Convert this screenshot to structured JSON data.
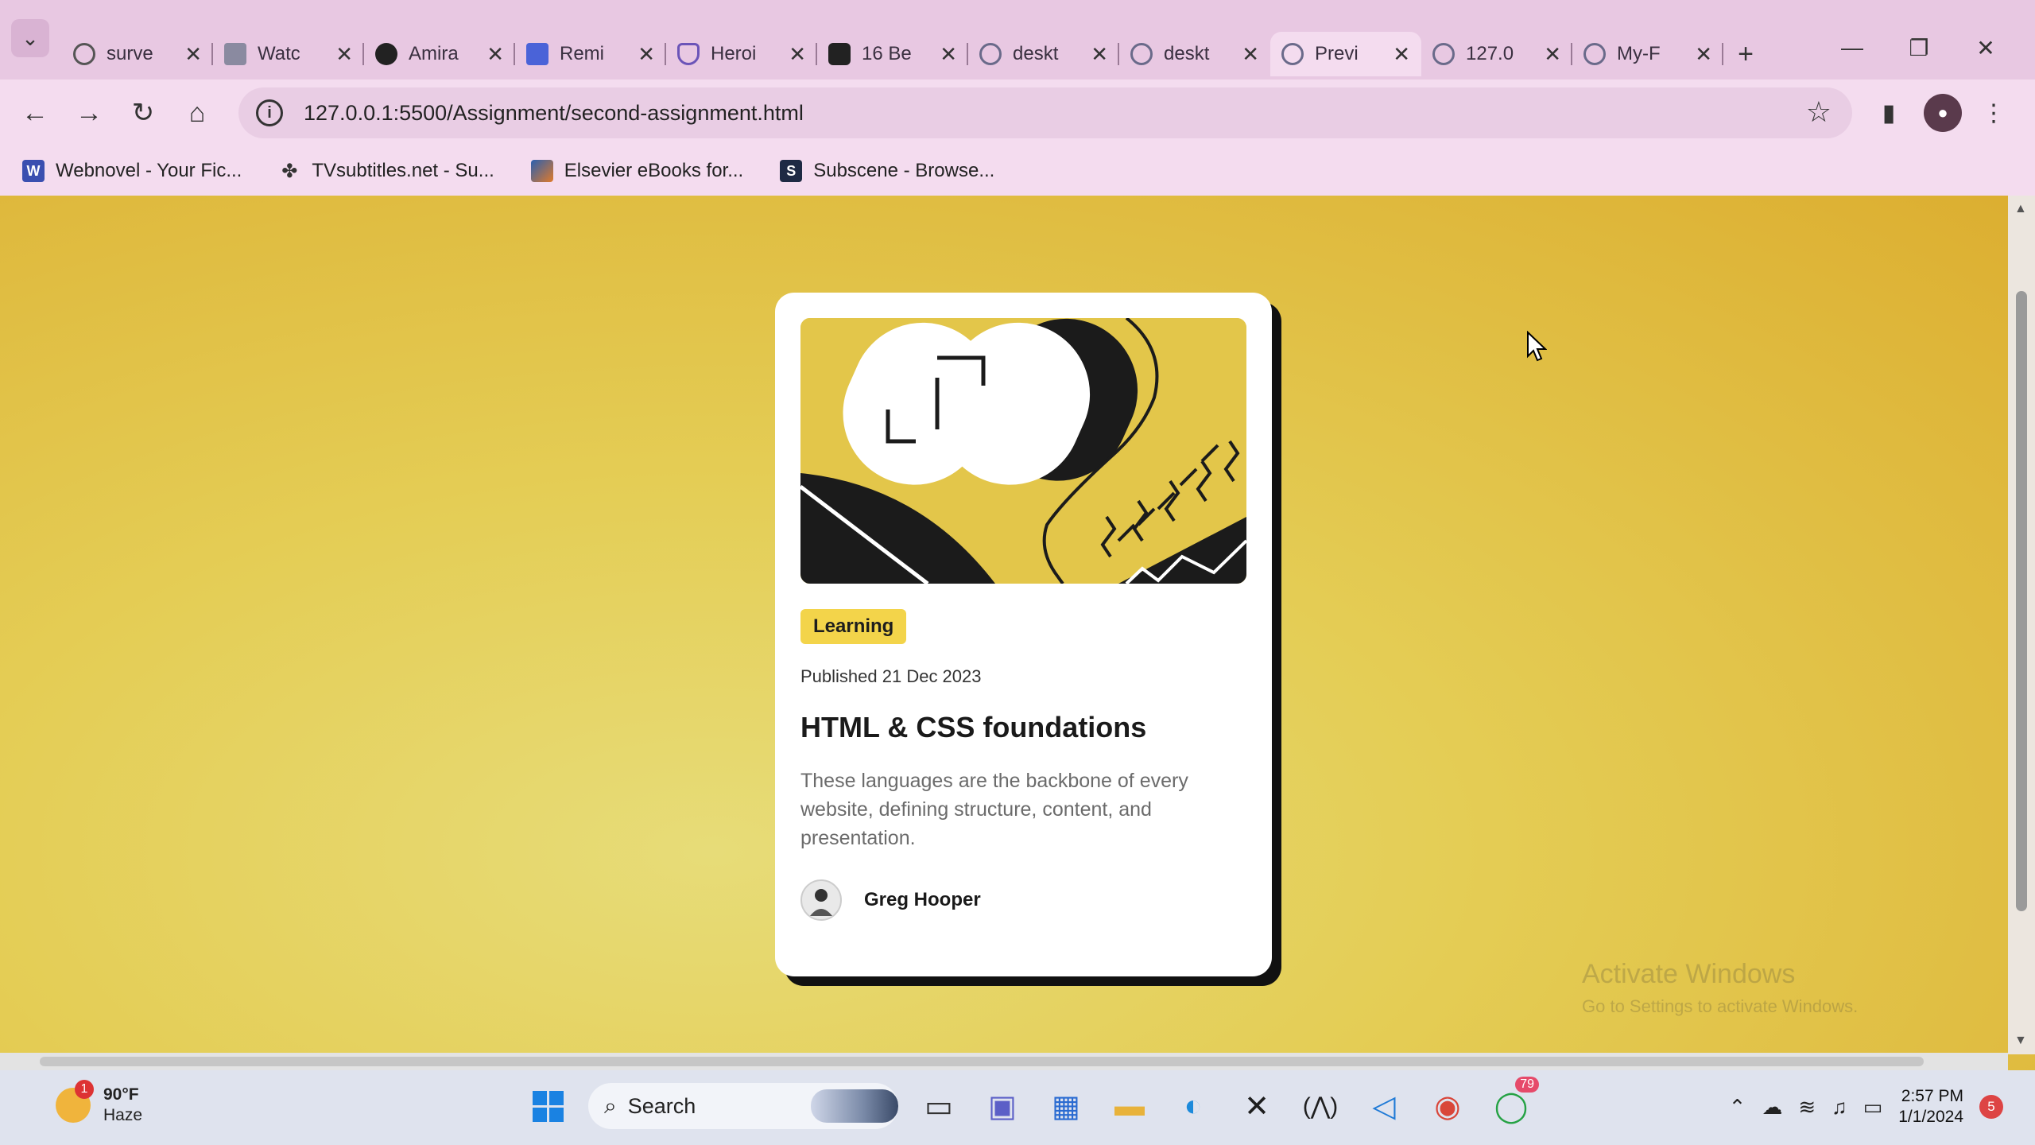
{
  "browser": {
    "tabs": [
      {
        "title": "surve",
        "icon": "loading-icon"
      },
      {
        "title": "Watc",
        "icon": "page-icon"
      },
      {
        "title": "Amira",
        "icon": "github-icon"
      },
      {
        "title": "Remi",
        "icon": "bookmark-icon"
      },
      {
        "title": "Heroi",
        "icon": "shield-icon"
      },
      {
        "title": "16 Be",
        "icon": "dice-icon"
      },
      {
        "title": "deskt",
        "icon": "globe-icon"
      },
      {
        "title": "deskt",
        "icon": "globe-icon"
      },
      {
        "title": "Previ",
        "icon": "globe-icon",
        "active": true
      },
      {
        "title": "127.0",
        "icon": "globe-icon"
      },
      {
        "title": "My-F",
        "icon": "globe-icon"
      }
    ],
    "new_tab": "+",
    "url": "127.0.0.1:5500/Assignment/second-assignment.html",
    "bookmarks": [
      {
        "label": "Webnovel - Your Fic...",
        "icon": "webnovel-icon"
      },
      {
        "label": "TVsubtitles.net - Su...",
        "icon": "tvsubtitles-icon"
      },
      {
        "label": "Elsevier eBooks for...",
        "icon": "elsevier-icon"
      },
      {
        "label": "Subscene - Browse...",
        "icon": "subscene-icon"
      }
    ]
  },
  "card": {
    "tag": "Learning",
    "published": "Published 21 Dec 2023",
    "title": "HTML & CSS foundations",
    "text": "These languages are the backbone of every website, defining structure, content, and presentation.",
    "author": "Greg Hooper"
  },
  "watermark": {
    "line1": "Activate Windows",
    "line2": "Go to Settings to activate Windows."
  },
  "taskbar": {
    "weather_temp": "90°F",
    "weather_cond": "Haze",
    "weather_badge": "1",
    "search": "Search",
    "whatsapp_badge": "79",
    "time": "2:57 PM",
    "date": "1/1/2024",
    "notifications": "5"
  },
  "colors": {
    "page_bg": "#e4cd55",
    "tag_bg": "#f3d44a",
    "tab_strip": "#e8c8e2"
  }
}
